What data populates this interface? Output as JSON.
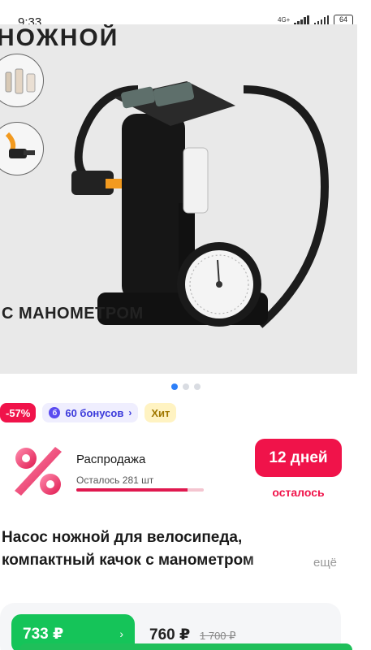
{
  "status_bar": {
    "time": "9:33",
    "network": "4G+",
    "battery": "64"
  },
  "gallery": {
    "heading_fragment": "НОЖНОЙ",
    "caption": "С МАНОМЕТРОМ",
    "active_index": 0,
    "dot_count": 3
  },
  "badges": {
    "discount": "-57%",
    "bonus": "60 бонусов",
    "hit": "Хит"
  },
  "sale": {
    "title": "Распродажа",
    "left": "Осталось 281 шт",
    "progress": 0.87,
    "days": "12 дней",
    "days_caption": "осталось"
  },
  "product": {
    "title_line1": "Насос ножной для велосипеда,",
    "title_line2": "компактный качок с манометром",
    "more": "ещё"
  },
  "price": {
    "card_price": "733 ₽",
    "current": "760 ₽",
    "old": "1 700 ₽"
  },
  "colors": {
    "accent_pink": "#f0134a",
    "accent_green": "#15c459",
    "bonus_purple": "#3b3adb",
    "dot_active": "#2d7ff9"
  }
}
